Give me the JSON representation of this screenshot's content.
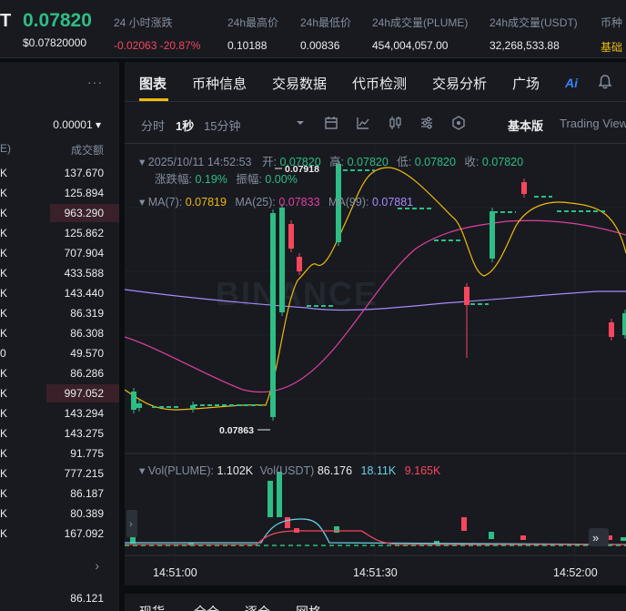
{
  "header": {
    "symbol_tail": "T",
    "last_price": "0.07820",
    "last_price_usd": "$0.07820000",
    "stats": [
      {
        "label": "24 小时涨跌",
        "value": "-0.02063 -20.87%",
        "color": "red"
      },
      {
        "label": "24h最高价",
        "value": "0.10188"
      },
      {
        "label": "24h最低价",
        "value": "0.00836"
      },
      {
        "label": "24h成交量(PLUME)",
        "value": "454,004,057.00"
      },
      {
        "label": "24h成交量(USDT)",
        "value": "32,268,533.88"
      },
      {
        "label": "币种",
        "value": "基础",
        "color": "yellow"
      }
    ]
  },
  "trades_panel": {
    "more": "···",
    "precision": "0.00001 ▾",
    "col_left": "E)",
    "col_right": "成交额",
    "rows": [
      {
        "k": "K",
        "v": "137.670",
        "bar": 0
      },
      {
        "k": "K",
        "v": "125.894",
        "bar": 0
      },
      {
        "k": "K",
        "v": "963.290",
        "bar": 76
      },
      {
        "k": "K",
        "v": "125.862",
        "bar": 0
      },
      {
        "k": "K",
        "v": "707.904",
        "bar": 0
      },
      {
        "k": "K",
        "v": "433.588",
        "bar": 0
      },
      {
        "k": "K",
        "v": "143.440",
        "bar": 0
      },
      {
        "k": "K",
        "v": "86.319",
        "bar": 0
      },
      {
        "k": "K",
        "v": "86.308",
        "bar": 0
      },
      {
        "k": "0",
        "v": "49.570",
        "bar": 0
      },
      {
        "k": "K",
        "v": "86.286",
        "bar": 0
      },
      {
        "k": "K",
        "v": "997.052",
        "bar": 80
      },
      {
        "k": "K",
        "v": "143.294",
        "bar": 0
      },
      {
        "k": "K",
        "v": "143.275",
        "bar": 0
      },
      {
        "k": "K",
        "v": "91.775",
        "bar": 0
      },
      {
        "k": "K",
        "v": "777.215",
        "bar": 0
      },
      {
        "k": "K",
        "v": "86.187",
        "bar": 0
      },
      {
        "k": "K",
        "v": "80.389",
        "bar": 0
      },
      {
        "k": "K",
        "v": "167.092",
        "bar": 0
      }
    ],
    "chevron": "›",
    "last_value": "86.121"
  },
  "tabs": [
    "图表",
    "币种信息",
    "交易数据",
    "代币检测",
    "交易分析",
    "广场"
  ],
  "ai_label": "Ai",
  "toolbar": {
    "items": [
      "分时",
      "1秒",
      "15分钟"
    ],
    "active_index": 1,
    "mode": "基本版",
    "tv": "Trading View"
  },
  "chart_info": {
    "datetime": "2025/10/11 14:52:53",
    "open_label": "开:",
    "open": "0.07820",
    "high_label": "高:",
    "high": "0.07820",
    "low_label": "低:",
    "low": "0.07820",
    "close_label": "收:",
    "close": "0.07820",
    "chg_label": "涨跌幅:",
    "chg": "0.19%",
    "amp_label": "振幅:",
    "amp": "0.00%",
    "ma7_label": "MA(7):",
    "ma7": "0.07819",
    "ma25_label": "MA(25):",
    "ma25": "0.07833",
    "ma99_label": "MA(99):",
    "ma99": "0.07881",
    "vol_label": "Vol(PLUME):",
    "vol": "1.102K",
    "volusdt_label": "Vol(USDT)",
    "volusdt": "86.176",
    "vol_ma1": "18.11K",
    "vol_ma2": "9.165K",
    "hi_marker": "0.07918",
    "lo_marker": "0.07863",
    "watermark": "BINANCE"
  },
  "xaxis": [
    "14:51:00",
    "14:51:30",
    "14:52:00"
  ],
  "bottom_tabs": [
    "现货",
    "全仓",
    "逐仓",
    "网格"
  ],
  "colors": {
    "up": "#2ebd85",
    "down": "#f6465d",
    "ma7": "#f0b90b",
    "ma25": "#e040a0",
    "ma99": "#a78bfa",
    "accent": "#f0b90b"
  },
  "chart_data": {
    "type": "candlestick",
    "x": [
      "14:51:00",
      "14:51:30",
      "14:52:00"
    ],
    "series": [
      {
        "name": "MA(7)",
        "value": 0.07819
      },
      {
        "name": "MA(25)",
        "value": 0.07833
      },
      {
        "name": "MA(99)",
        "value": 0.07881
      }
    ],
    "high_marker": 0.07918,
    "low_marker": 0.07863
  }
}
